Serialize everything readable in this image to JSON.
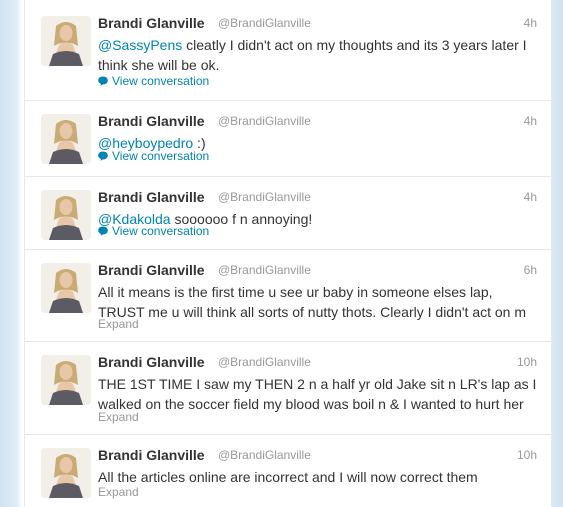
{
  "colors": {
    "link": "#0084b4",
    "name": "#333333",
    "meta": "#999999"
  },
  "tweets": [
    {
      "name": "Brandi Glanville",
      "handle": "@BrandiGlanville",
      "time": "4h",
      "mention": "@SassyPens",
      "line1": " cleatly I didn't act on my thoughts and its 3 years later I",
      "line2": "think she will be ok.",
      "action": "View conversation",
      "action_icon": "speech-bubble-icon"
    },
    {
      "name": "Brandi Glanville",
      "handle": "@BrandiGlanville",
      "time": "4h",
      "mention": "@heyboypedro",
      "line1": " :)",
      "action": "View conversation",
      "action_icon": "speech-bubble-icon"
    },
    {
      "name": "Brandi Glanville",
      "handle": "@BrandiGlanville",
      "time": "4h",
      "mention": "@Kdakolda",
      "line1": " soooooo f n annoying!",
      "action": "View conversation",
      "action_icon": "speech-bubble-icon"
    },
    {
      "name": "Brandi Glanville",
      "handle": "@BrandiGlanville",
      "time": "6h",
      "line1": "All it means is the first time u see ur baby in someone elses lap,",
      "line2": "TRUST me u will think all sorts of nutty thots. Clearly I didn't act on m",
      "action": "Expand"
    },
    {
      "name": "Brandi Glanville",
      "handle": "@BrandiGlanville",
      "time": "10h",
      "line1": "THE 1ST TIME I saw my THEN 2 n a half yr old Jake sit n LR's lap as I",
      "line2": "walked on the soccer field my blood was boil n & I wanted to hurt her",
      "action": "Expand"
    },
    {
      "name": "Brandi Glanville",
      "handle": "@BrandiGlanville",
      "time": "10h",
      "line1": "All the articles online are incorrect and I will now correct them",
      "action": "Expand"
    }
  ]
}
